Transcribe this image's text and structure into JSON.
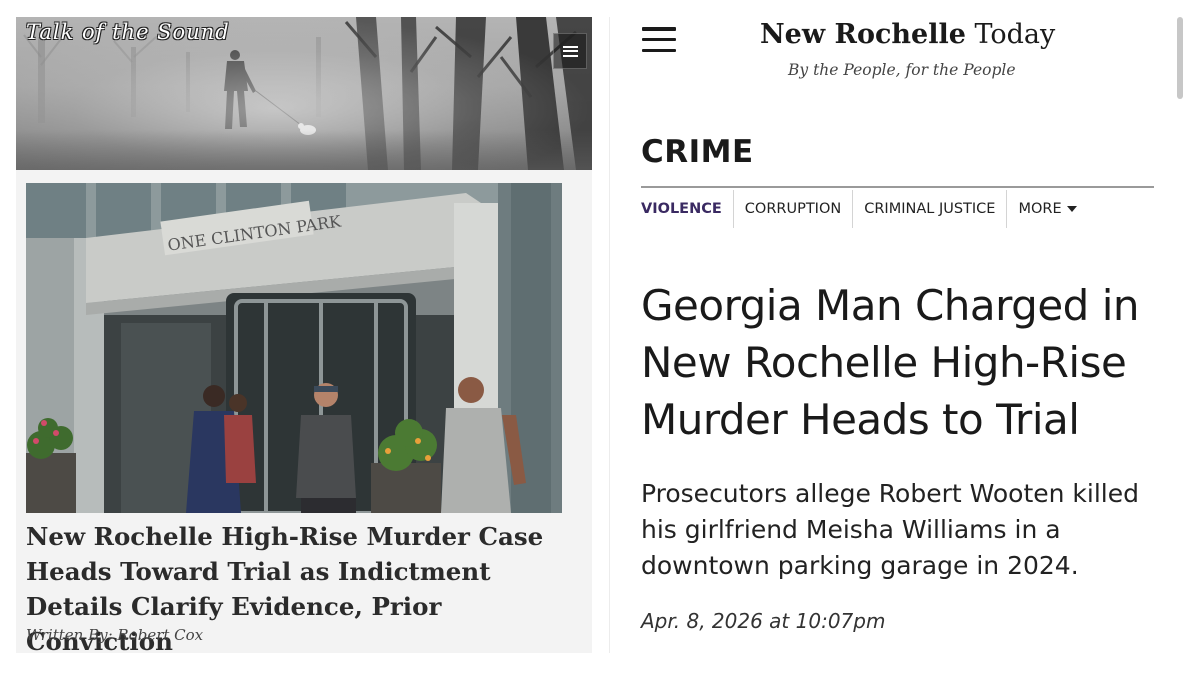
{
  "left": {
    "site_title": "Talk of the Sound",
    "building_sign": "ONE CLINTON PARK",
    "headline": "New Rochelle High-Rise Murder Case Heads Toward Trial as Indictment Details Clarify Evidence, Prior Conviction",
    "byline": "Written By: Robert Cox",
    "menu_icon": "hamburger-menu-icon"
  },
  "right": {
    "brand_bold": "New Rochelle",
    "brand_light": "Today",
    "tagline": "By the People, for the People",
    "section": "CRIME",
    "subnav": [
      {
        "label": "VIOLENCE",
        "active": true
      },
      {
        "label": "CORRUPTION",
        "active": false
      },
      {
        "label": "CRIMINAL JUSTICE",
        "active": false
      },
      {
        "label": "MORE",
        "active": false
      }
    ],
    "headline": "Georgia Man Charged in New Rochelle High-Rise Murder Heads to Trial",
    "dek": "Prosecutors allege Robert Wooten killed his girlfriend Meisha Williams in a downtown parking garage in 2024.",
    "date": "Apr. 8, 2026 at 10:07pm",
    "menu_icon": "hamburger-menu-icon"
  },
  "colors": {
    "subnav_active": "#3a2a62",
    "text_dark": "#1a1a1a",
    "left_panel_bg": "#f3f3f3"
  }
}
